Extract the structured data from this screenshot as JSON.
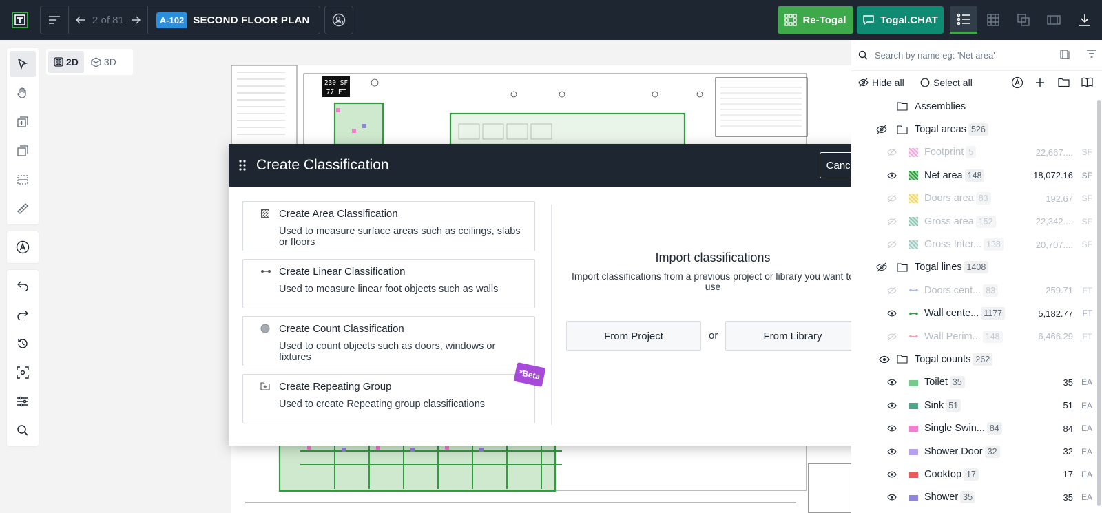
{
  "toolbar": {
    "page_counter": "2 of 81",
    "sheet_badge": "A-102",
    "sheet_title": "SECOND FLOOR PLAN",
    "retogal_label": "Re-Togal",
    "chat_label": "Togal.CHAT"
  },
  "view_toggle": {
    "opt_2d": "2D",
    "opt_3d": "3D"
  },
  "drawing_label": {
    "line1": "230 SF",
    "line2": "77 FT"
  },
  "modal": {
    "title": "Create Classification",
    "cancel": "Cancel",
    "options": [
      {
        "title": "Create Area Classification",
        "desc": "Used to measure surface areas such as ceilings, slabs or floors"
      },
      {
        "title": "Create Linear Classification",
        "desc": "Used to measure linear foot objects such as walls"
      },
      {
        "title": "Create Count Classification",
        "desc": "Used to count objects such as doors, windows or fixtures"
      },
      {
        "title": "Create Repeating Group",
        "desc": "Used to create Repeating group classifications"
      }
    ],
    "beta": "*Beta",
    "import_title": "Import classifications",
    "import_desc": "Import classifications from a previous project or library you want to use",
    "from_project": "From Project",
    "or": "or",
    "from_library": "From Library"
  },
  "panel": {
    "search_placeholder": "Search by name eg: 'Net area'",
    "hide_all": "Hide all",
    "select_all": "Select all",
    "assemblies": "Assemblies",
    "groups": [
      {
        "name": "Togal areas",
        "count": "526",
        "items": [
          {
            "name": "Footprint",
            "count": "5",
            "value": "22,667....",
            "unit": "SF",
            "color": "#f3a6d8",
            "dim": true
          },
          {
            "name": "Net area",
            "count": "148",
            "value": "18,072.16",
            "unit": "SF",
            "color": "#2e9e3e",
            "dim": false
          },
          {
            "name": "Doors area",
            "count": "83",
            "value": "192.67",
            "unit": "SF",
            "color": "#f2d86b",
            "dim": true
          },
          {
            "name": "Gross area",
            "count": "152",
            "value": "22,342....",
            "unit": "SF",
            "color": "#8cc5b5",
            "dim": true
          },
          {
            "name": "Gross Inter...",
            "count": "138",
            "value": "20,707....",
            "unit": "SF",
            "color": "#9fc9c1",
            "dim": true
          }
        ]
      },
      {
        "name": "Togal lines",
        "count": "1408",
        "items": [
          {
            "name": "Doors cent...",
            "count": "83",
            "value": "259.71",
            "unit": "FT",
            "color": "#a9b7e8",
            "dim": true
          },
          {
            "name": "Wall cente...",
            "count": "1177",
            "value": "5,182.77",
            "unit": "FT",
            "color": "#2e9e3e",
            "dim": false
          },
          {
            "name": "Wall Perim...",
            "count": "148",
            "value": "6,466.29",
            "unit": "FT",
            "color": "#f3a1ae",
            "dim": true
          }
        ]
      },
      {
        "name": "Togal counts",
        "count": "262",
        "items": [
          {
            "name": "Toilet",
            "count": "35",
            "value": "35",
            "unit": "EA",
            "color": "#78c98b",
            "dim": false
          },
          {
            "name": "Sink",
            "count": "51",
            "value": "51",
            "unit": "EA",
            "color": "#4fa58a",
            "dim": false
          },
          {
            "name": "Single Swin...",
            "count": "84",
            "value": "84",
            "unit": "EA",
            "color": "#f07fcf",
            "dim": false
          },
          {
            "name": "Shower Door",
            "count": "32",
            "value": "32",
            "unit": "EA",
            "color": "#b7a1ef",
            "dim": false
          },
          {
            "name": "Cooktop",
            "count": "17",
            "value": "17",
            "unit": "EA",
            "color": "#ee5a5a",
            "dim": false
          },
          {
            "name": "Shower",
            "count": "35",
            "value": "35",
            "unit": "EA",
            "color": "#8f86d6",
            "dim": false
          }
        ]
      }
    ]
  }
}
